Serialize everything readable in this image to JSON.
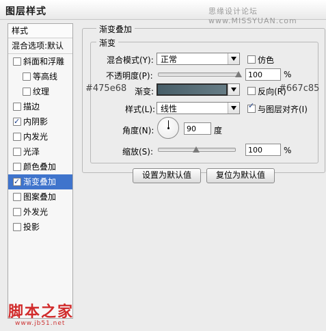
{
  "window": {
    "title": "图层样式",
    "watermark": "思缘设计论坛  www.MISSYUAN.com"
  },
  "sidebar": {
    "header": "样式",
    "blend_options": "混合选项:默认",
    "items": [
      {
        "label": "斜面和浮雕",
        "checked": false,
        "sub": false,
        "active": false
      },
      {
        "label": "等高线",
        "checked": false,
        "sub": true,
        "active": false
      },
      {
        "label": "纹理",
        "checked": false,
        "sub": true,
        "active": false
      },
      {
        "label": "描边",
        "checked": false,
        "sub": false,
        "active": false
      },
      {
        "label": "内阴影",
        "checked": true,
        "sub": false,
        "active": false
      },
      {
        "label": "内发光",
        "checked": false,
        "sub": false,
        "active": false
      },
      {
        "label": "光泽",
        "checked": false,
        "sub": false,
        "active": false
      },
      {
        "label": "颜色叠加",
        "checked": false,
        "sub": false,
        "active": false
      },
      {
        "label": "渐变叠加",
        "checked": true,
        "sub": false,
        "active": true
      },
      {
        "label": "图案叠加",
        "checked": false,
        "sub": false,
        "active": false
      },
      {
        "label": "外发光",
        "checked": false,
        "sub": false,
        "active": false
      },
      {
        "label": "投影",
        "checked": false,
        "sub": false,
        "active": false
      }
    ]
  },
  "panel": {
    "group_title": "渐变叠加",
    "sub_group_title": "渐变",
    "blend_mode": {
      "label": "混合模式(Y):",
      "value": "正常"
    },
    "dither": {
      "label": "仿色",
      "checked": false
    },
    "opacity": {
      "label": "不透明度(P):",
      "value": "100",
      "unit": "%",
      "fraction": 1.0
    },
    "gradient": {
      "label": "渐变:",
      "start_color": "#475e68",
      "end_color": "#667c85",
      "start_annotation": "#475e68",
      "end_annotation": "#667c85"
    },
    "reverse": {
      "label": "反向(R)",
      "checked": false
    },
    "style": {
      "label": "样式(L):",
      "value": "线性"
    },
    "align_layer": {
      "label": "与图层对齐(I)",
      "checked": true
    },
    "angle": {
      "label": "角度(N):",
      "value": "90",
      "unit": "度"
    },
    "scale": {
      "label": "缩放(S):",
      "value": "100",
      "unit": "%",
      "fraction": 0.5
    },
    "buttons": {
      "set_default": "设置为默认值",
      "reset_default": "复位为默认值"
    }
  },
  "footer": {
    "site_logo": "脚本之家",
    "site_url": "www.jb51.net"
  }
}
